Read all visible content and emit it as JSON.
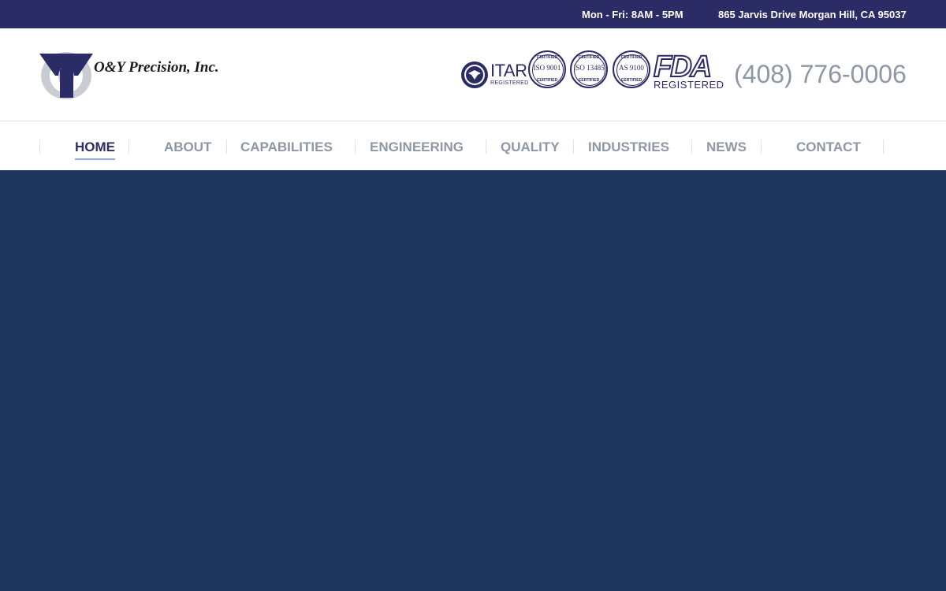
{
  "topbar": {
    "hours": "Mon - Fri: 8AM - 5PM",
    "address": "865 Jarvis Drive Morgan Hill, CA 95037"
  },
  "header": {
    "company_name": "O&Y Precision, Inc.",
    "phone": "(408) 776-0006",
    "certifications": {
      "itar": {
        "label": "ITAR",
        "sub": "REGISTERED"
      },
      "iso9001": {
        "top": "CERTIFIED",
        "label": "ISO 9001",
        "bottom": "CERTIFIED"
      },
      "iso13485": {
        "top": "CERTIFIED",
        "label": "ISO 13485",
        "bottom": "CERTIFIED"
      },
      "as9100": {
        "top": "CERTIFIED",
        "label": "AS 9100",
        "bottom": "CERTIFIED"
      },
      "fda": {
        "label": "FDA",
        "sub": "REGISTERED"
      }
    }
  },
  "nav": {
    "items": [
      {
        "label": "HOME",
        "active": true
      },
      {
        "label": "ABOUT"
      },
      {
        "label": "CAPABILITIES"
      },
      {
        "label": "ENGINEERING"
      },
      {
        "label": "QUALITY"
      },
      {
        "label": "INDUSTRIES"
      },
      {
        "label": "NEWS"
      },
      {
        "label": "CONTACT"
      }
    ]
  },
  "colors": {
    "topbar_bg": "#2b2b66",
    "hero_bg": "#1f365d",
    "nav_text": "#8e97a4",
    "nav_active": "#2b2b66",
    "phone": "#8e97a4"
  }
}
